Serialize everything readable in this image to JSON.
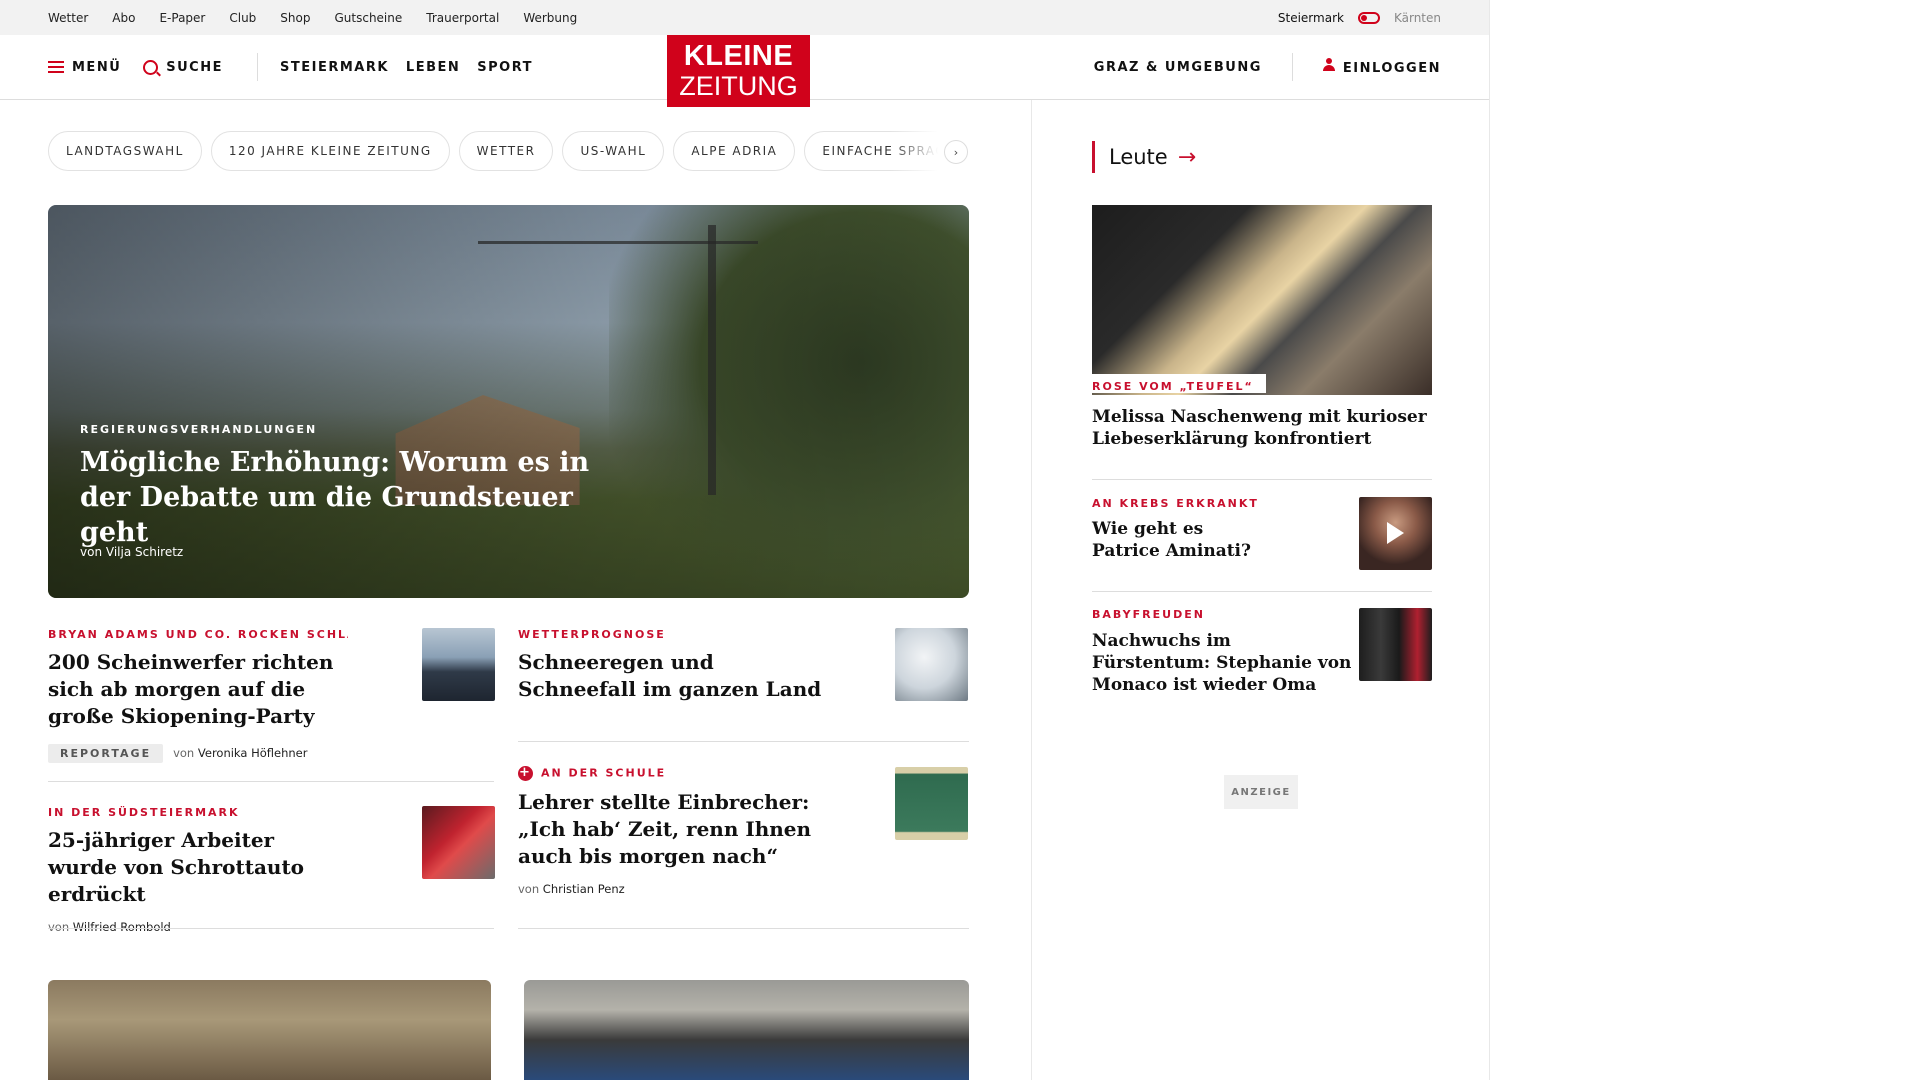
{
  "topbar": {
    "links": [
      "Wetter",
      "Abo",
      "E-Paper",
      "Club",
      "Shop",
      "Gutscheine",
      "Trauerportal",
      "Werbung"
    ],
    "region_active": "Steiermark",
    "region_other": "Kärnten"
  },
  "header": {
    "menu_label": "MENÜ",
    "search_label": "SUCHE",
    "nav": [
      "STEIERMARK",
      "LEBEN",
      "SPORT"
    ],
    "logo_line1": "KLEINE",
    "logo_line2": "ZEITUNG",
    "local_label": "GRAZ & UMGEBUNG",
    "login_label": "EINLOGGEN"
  },
  "pills": [
    "LANDTAGSWAHL",
    "120 JAHRE KLEINE ZEITUNG",
    "WETTER",
    "US-WAHL",
    "ALPE ADRIA",
    "EINFACHE SPRACHE"
  ],
  "hero": {
    "kicker": "REGIERUNGSVERHANDLUNGEN",
    "title": "Mögliche Erhöhung: Worum es in der Debatte um die Grundsteuer geht",
    "byline_prefix": "von",
    "author": "Vilja Schiretz"
  },
  "articles": {
    "a1": {
      "kicker": "BRYAN ADAMS UND CO. ROCKEN SCHLAD…",
      "title": "200 Scheinwerfer richten sich ab morgen auf die große Skiopening-Party",
      "tag": "REPORTAGE",
      "byline_prefix": "von",
      "author": "Veronika Höflehner",
      "thumb_color": "#4f6a86"
    },
    "a2": {
      "kicker": "WETTERPROGNOSE",
      "title": "Schneeregen und Schneefall im ganzen Land",
      "thumb_color": "#c9d2da"
    },
    "a3": {
      "kicker": "IN DER SÜDSTEIERMARK",
      "title": "25-jähriger Arbeiter wurde von Schrottauto erdrückt",
      "byline_prefix": "von",
      "author": "Wilfried Rombold",
      "thumb_color": "#a3202a"
    },
    "a4": {
      "kicker": "AN DER SCHULE",
      "title": "Lehrer stellte Einbrecher: „Ich hab‘ Zeit, renn Ihnen auch bis morgen nach“",
      "byline_prefix": "von",
      "author": "Christian Penz",
      "thumb_color": "#3f6e57"
    }
  },
  "rail": {
    "heading": "Leute",
    "r1": {
      "kicker": "ROSE VOM „TEUFEL“",
      "title": "Melissa Naschenweng mit kurioser Liebeserklärung konfrontiert"
    },
    "r2": {
      "kicker": "AN KREBS ERKRANKT",
      "title": "Wie geht es Patrice Aminati?",
      "thumb_color": "#5a4038"
    },
    "r3": {
      "kicker": "BABYFREUDEN",
      "title": "Nachwuchs im Fürstentum: Stephanie von Monaco ist wieder Oma",
      "thumb_color": "#2a2a2a"
    },
    "ad_label": "ANZEIGE"
  },
  "colors": {
    "brand": "#d0021b",
    "kicker": "#c8102e"
  }
}
